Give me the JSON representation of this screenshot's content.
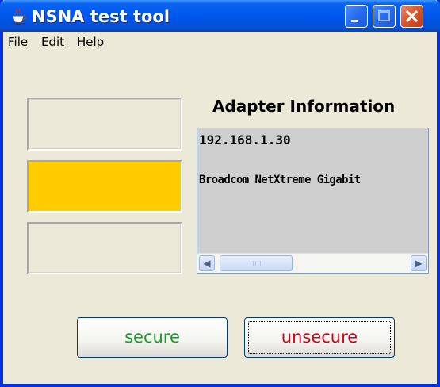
{
  "window": {
    "title": "NSNA test tool",
    "icon": "java-coffee-cup-icon",
    "controls": [
      "minimize-icon",
      "maximize-icon",
      "close-icon"
    ]
  },
  "menu": {
    "items": [
      {
        "label": "File"
      },
      {
        "label": "Edit"
      },
      {
        "label": "Help"
      }
    ]
  },
  "indicators": {
    "lights": [
      {
        "state": "off",
        "color": "#ece9d8"
      },
      {
        "state": "on",
        "color": "#ffcc00"
      },
      {
        "state": "off",
        "color": "#ece9d8"
      }
    ]
  },
  "adapter": {
    "heading": "Adapter Information",
    "ip_address": "192.168.1.30",
    "adapter_name": "Broadcom NetXtreme Gigabit"
  },
  "actions": {
    "secure_label": "secure",
    "unsecure_label": "unsecure"
  },
  "colors": {
    "title_bar": "#0054e3",
    "secure_text": "#1a9a2a",
    "unsecure_text": "#d0021b",
    "window_bg": "#ece9d8"
  }
}
